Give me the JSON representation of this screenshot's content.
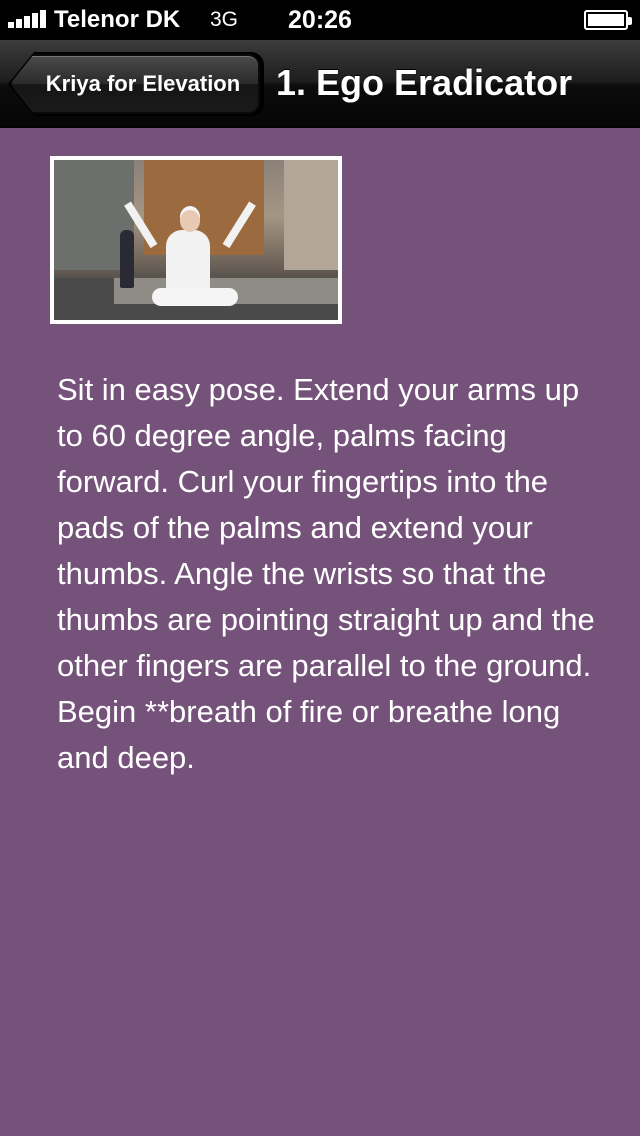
{
  "status_bar": {
    "carrier": "Telenor DK",
    "network": "3G",
    "time": "20:26",
    "signal_bars": 5,
    "battery_level": 1.0
  },
  "nav": {
    "back_label": "Kriya for Elevation",
    "title": "1. Ego Eradicator"
  },
  "content": {
    "image_description_icon": "yoga-photo",
    "description": "Sit in easy pose. Extend your arms up to 60 degree angle, palms facing forward. Curl your fingertips into the pads of the palms and extend your thumbs. Angle the wrists so that the thumbs are pointing straight up and the other fingers are parallel to the ground.\nBegin **breath of fire or breathe long and deep."
  },
  "colors": {
    "background": "#75527a",
    "nav_bar": "#1d1d1d",
    "text": "#ffffff"
  }
}
